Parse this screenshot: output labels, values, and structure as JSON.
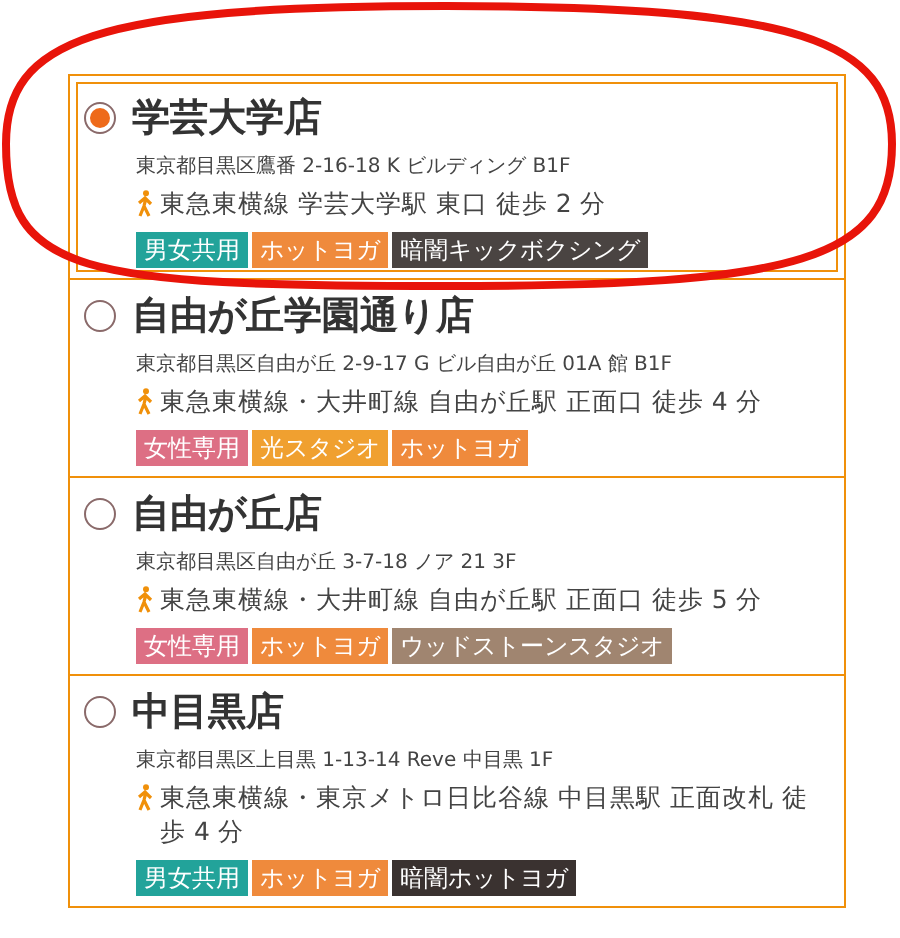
{
  "stores": [
    {
      "name": "学芸大学店",
      "selected": true,
      "address": "東京都目黒区鷹番 2-16-18 K ビルディング B1F",
      "access": "東急東横線 学芸大学駅 東口 徒歩 2 分",
      "tags": [
        {
          "label": "男女共用",
          "color": "#22a39a"
        },
        {
          "label": "ホットヨガ",
          "color": "#ef8a3c"
        },
        {
          "label": "暗闇キックボクシング",
          "color": "#4a4442"
        }
      ]
    },
    {
      "name": "自由が丘学園通り店",
      "selected": false,
      "address": "東京都目黒区自由が丘 2-9-17 G ビル自由が丘 01A 館 B1F",
      "access": "東急東横線・大井町線 自由が丘駅 正面口 徒歩 4 分",
      "tags": [
        {
          "label": "女性専用",
          "color": "#dd6f84"
        },
        {
          "label": "光スタジオ",
          "color": "#f0a030"
        },
        {
          "label": "ホットヨガ",
          "color": "#ef8a3c"
        }
      ]
    },
    {
      "name": "自由が丘店",
      "selected": false,
      "address": "東京都目黒区自由が丘 3-7-18 ノア 21 3F",
      "access": "東急東横線・大井町線 自由が丘駅 正面口 徒歩 5 分",
      "tags": [
        {
          "label": "女性専用",
          "color": "#dd6f84"
        },
        {
          "label": "ホットヨガ",
          "color": "#ef8a3c"
        },
        {
          "label": "ウッドストーンスタジオ",
          "color": "#a08570"
        }
      ]
    },
    {
      "name": "中目黒店",
      "selected": false,
      "address": "東京都目黒区上目黒 1-13-14 Reve 中目黒 1F",
      "access": "東急東横線・東京メトロ日比谷線 中目黒駅 正面改札 徒歩 4 分",
      "tags": [
        {
          "label": "男女共用",
          "color": "#22a39a"
        },
        {
          "label": "ホットヨガ",
          "color": "#ef8a3c"
        },
        {
          "label": "暗闇ホットヨガ",
          "color": "#3a3230"
        }
      ]
    }
  ]
}
